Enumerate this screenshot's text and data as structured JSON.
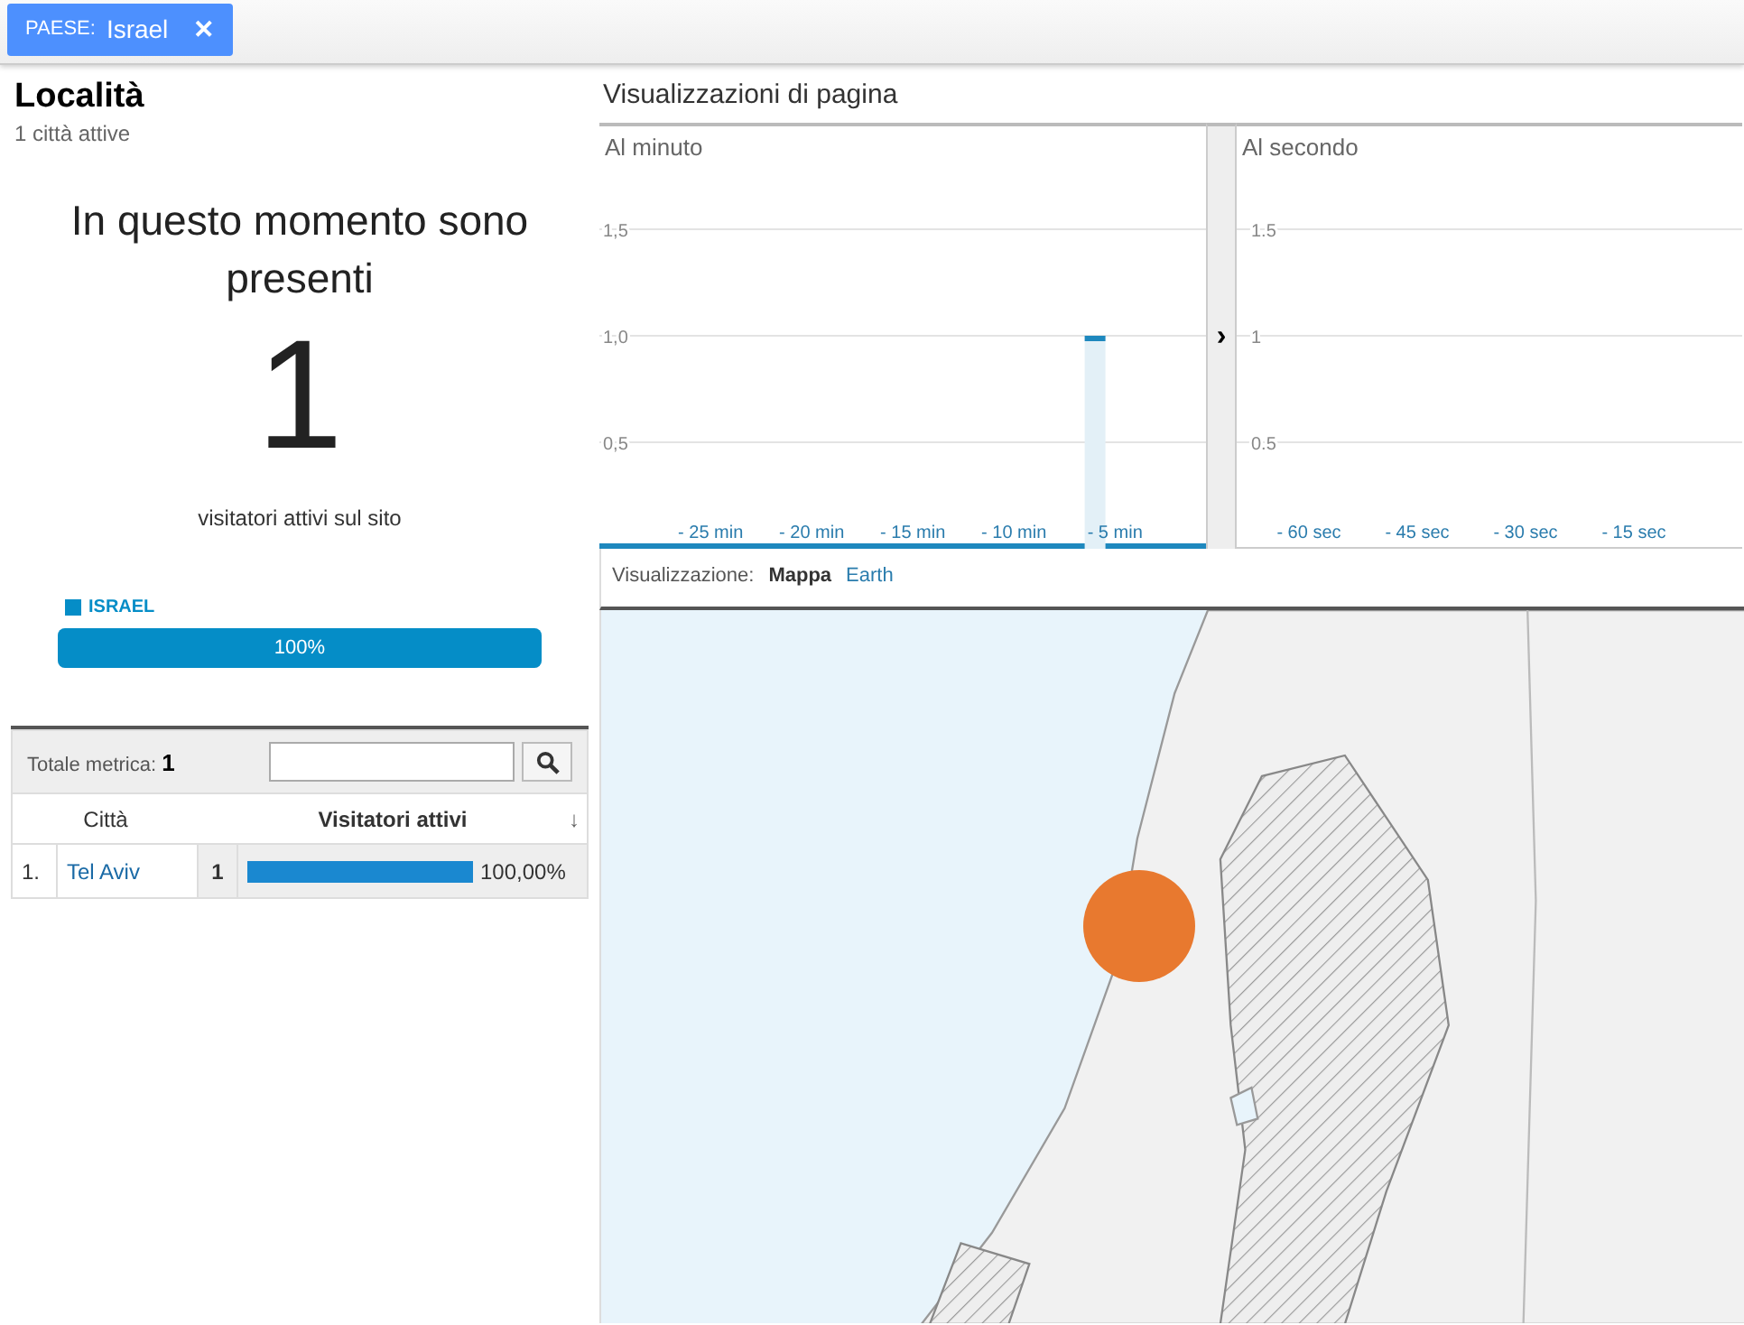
{
  "filter_chip": {
    "label": "PAESE:",
    "value": "Israel",
    "close": "✕"
  },
  "header": {
    "title": "Località",
    "subtitle": "1 città attive"
  },
  "now": {
    "heading": "In questo momento sono presenti",
    "count": "1",
    "caption": "visitatori attivi sul sito"
  },
  "country_bar": {
    "legend": "ISRAEL",
    "color": "#058dc7",
    "level": 1,
    "reading": "100%"
  },
  "table": {
    "total_label": "Totale metrica:",
    "total_value": "1",
    "columns": [
      "Città",
      "Visitatori attivi"
    ],
    "sort_icon": "↓",
    "rows": [
      {
        "index": "1.",
        "city": "Tel Aviv",
        "value": "1",
        "level": 1,
        "percent": "100,00%"
      }
    ]
  },
  "pageviews": {
    "title": "Visualizzazioni di pagina",
    "expand": "›",
    "charts": [
      {
        "subtitle": "Al minuto",
        "chart_data": {
          "type": "bar",
          "x": [
            -30,
            -29,
            -28,
            -27,
            -26,
            -25,
            -24,
            -23,
            -22,
            -21,
            -20,
            -19,
            -18,
            -17,
            -16,
            -15,
            -14,
            -13,
            -12,
            -11,
            -10,
            -9,
            -8,
            -7,
            -6,
            -5,
            -4,
            -3,
            -2,
            -1
          ],
          "values": [
            0,
            0,
            0,
            0,
            0,
            0,
            0,
            0,
            0,
            0,
            0,
            0,
            0,
            0,
            0,
            0,
            0,
            0,
            0,
            0,
            0,
            0,
            0,
            0,
            1,
            0,
            0,
            0,
            0,
            0
          ],
          "xlim": [
            -30.5,
            -0.5
          ],
          "ylim": [
            0,
            2
          ],
          "grid": true,
          "yticks": [
            {
              "value": 0.5,
              "label": "0,5"
            },
            {
              "value": 1,
              "label": "1,0"
            },
            {
              "value": 1.5,
              "label": "1,5"
            }
          ],
          "xticks": [
            {
              "value": -25,
              "label": "- 25 min"
            },
            {
              "value": -20,
              "label": "- 20 min"
            },
            {
              "value": -15,
              "label": "- 15 min"
            },
            {
              "value": -10,
              "label": "- 10 min"
            },
            {
              "value": -5,
              "label": "- 5 min"
            }
          ]
        }
      },
      {
        "subtitle": "Al secondo",
        "chart_data": {
          "type": "bar",
          "xlim": [
            -70,
            0
          ],
          "ylim": [
            0,
            2
          ],
          "grid": true,
          "yticks": [
            {
              "value": 0.5,
              "label": "0.5"
            },
            {
              "value": 1,
              "label": "1"
            },
            {
              "value": 1.5,
              "label": "1.5"
            }
          ],
          "xticks": [
            {
              "value": -60,
              "label": "- 60 sec"
            },
            {
              "value": -45,
              "label": "- 45 sec"
            },
            {
              "value": -30,
              "label": "- 30 sec"
            },
            {
              "value": -15,
              "label": "- 15 sec"
            }
          ]
        }
      }
    ]
  },
  "view_switch": {
    "label": "Visualizzazione:",
    "options": [
      {
        "label": "Mappa",
        "selected": true
      },
      {
        "label": "Earth",
        "selected": false
      }
    ]
  },
  "map": {
    "kind": "picture",
    "markers": [
      {
        "color": "#e8792f"
      }
    ]
  }
}
